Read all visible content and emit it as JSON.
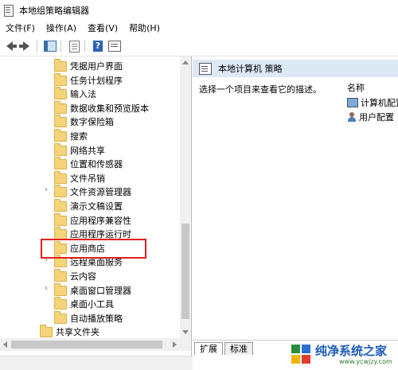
{
  "window": {
    "title": "本地组策略编辑器"
  },
  "menu": [
    "文件(F)",
    "操作(A)",
    "查看(V)",
    "帮助(H)"
  ],
  "toolbar": {
    "icons": [
      "back-icon",
      "forward-icon",
      "show-hide-tree-icon",
      "export-list-icon",
      "help-icon",
      "properties-icon"
    ]
  },
  "tree": {
    "items": [
      {
        "label": "凭据用户界面",
        "expandable": false
      },
      {
        "label": "任务计划程序",
        "expandable": false
      },
      {
        "label": "输入法",
        "expandable": false
      },
      {
        "label": "数据收集和预览版本",
        "expandable": false
      },
      {
        "label": "数字保险箱",
        "expandable": false
      },
      {
        "label": "搜索",
        "expandable": false
      },
      {
        "label": "网络共享",
        "expandable": false
      },
      {
        "label": "位置和传感器",
        "expandable": false
      },
      {
        "label": "文件吊销",
        "expandable": false
      },
      {
        "label": "文件资源管理器",
        "expandable": true
      },
      {
        "label": "演示文稿设置",
        "expandable": false
      },
      {
        "label": "应用程序兼容性",
        "expandable": false
      },
      {
        "label": "应用程序运行时",
        "expandable": false
      },
      {
        "label": "应用商店",
        "expandable": false
      },
      {
        "label": "远程桌面服务",
        "expandable": true
      },
      {
        "label": "云内容",
        "expandable": false
      },
      {
        "label": "桌面窗口管理器",
        "expandable": true
      },
      {
        "label": "桌面小工具",
        "expandable": false
      },
      {
        "label": "自动播放策略",
        "expandable": false
      },
      {
        "label": "共享文件夹",
        "expandable": false
      }
    ],
    "highlighted": "文件资源管理器"
  },
  "right_pane": {
    "header": "本地计算机 策略",
    "description": "选择一个项目来查看它的描述。",
    "column_name": "名称",
    "items": [
      "计算机配置",
      "用户配置"
    ]
  },
  "tabs": [
    "扩展",
    "标准"
  ],
  "watermark": {
    "main": "纯净系统之家",
    "url": "www.ycwjzy.com"
  },
  "colors": {
    "highlight_border": "#e0201d",
    "header_bg": "#dde8f5",
    "folder": "#f5d37a"
  }
}
